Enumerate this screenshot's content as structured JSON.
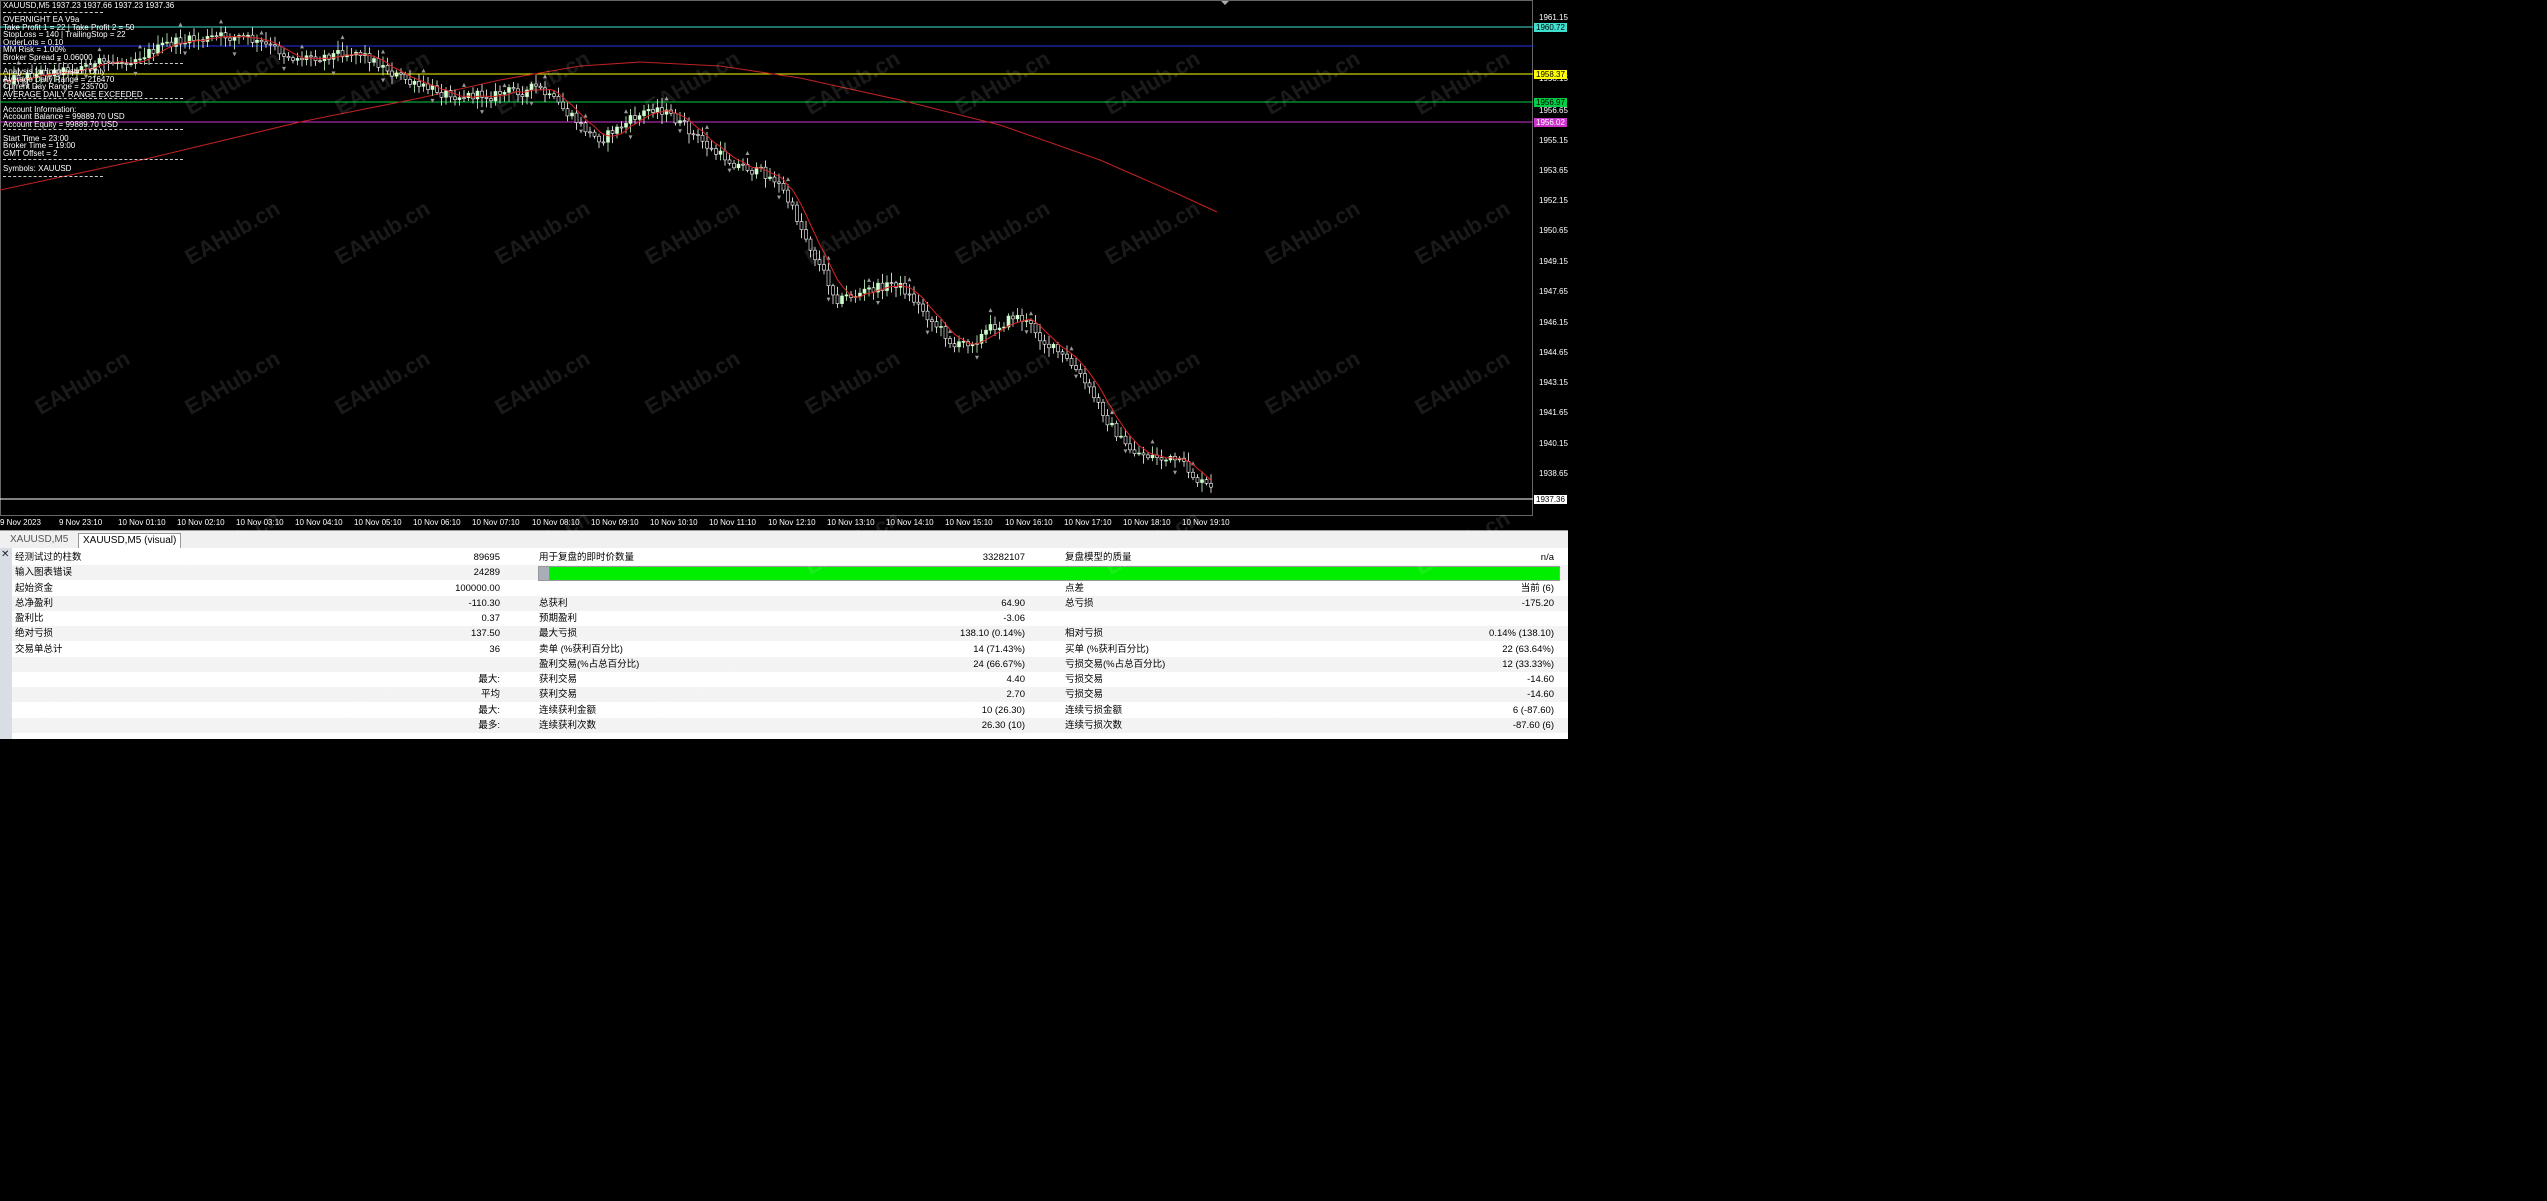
{
  "chart": {
    "header": "XAUUSD,M5  1937.23 1937.66 1937.23 1937.36",
    "info_lines": [
      "OVERNIGHT EA V9a",
      "Take Profit 1 = 22 | Take Profit 2 = 50",
      "StopLoss = 140 | TrailingStop = 22",
      "OrderLots = 0.10",
      "MM Risk = 1.00%",
      "Broker Spread = 0.06000",
      "Analysis for Information Only",
      "Average Daily Range = 216470",
      "Current Day Range = 235700",
      "AVERAGE DAILY RANGE EXCEEDED",
      "Account Information:",
      "Account Balance = 99889.70 USD",
      "Account Equity  = 99889.70 USD",
      "Start Time = 23:00",
      "Broker Time = 19:00",
      "GMT Offset = 2",
      "Symbols: XAUUSD"
    ],
    "price_ticks": [
      "1961.15",
      "1958.15",
      "1956.65",
      "1955.15",
      "1953.65",
      "1952.15",
      "1950.65",
      "1949.15",
      "1947.65",
      "1946.15",
      "1944.65",
      "1943.15",
      "1941.65",
      "1940.15",
      "1938.65"
    ],
    "price_tags": [
      {
        "text": "1960.72",
        "bg": "#40e0d0",
        "fg": "#000"
      },
      {
        "text": "1958.37",
        "bg": "#ffff00",
        "fg": "#000"
      },
      {
        "text": "1956.97",
        "bg": "#00cc44",
        "fg": "#000"
      },
      {
        "text": "1956.02",
        "bg": "#cc33cc",
        "fg": "#fff"
      },
      {
        "text": "1937.36",
        "bg": "#ffffff",
        "fg": "#000"
      }
    ],
    "time_ticks": [
      "9 Nov 2023",
      "9 Nov 23:10",
      "10 Nov 01:10",
      "10 Nov 02:10",
      "10 Nov 03:10",
      "10 Nov 04:10",
      "10 Nov 05:10",
      "10 Nov 06:10",
      "10 Nov 07:10",
      "10 Nov 08:10",
      "10 Nov 09:10",
      "10 Nov 10:10",
      "10 Nov 11:10",
      "10 Nov 12:10",
      "10 Nov 13:10",
      "10 Nov 14:10",
      "10 Nov 15:10",
      "10 Nov 16:10",
      "10 Nov 17:10",
      "10 Nov 18:10",
      "10 Nov 19:10"
    ],
    "watermark": "EAHub.cn",
    "colors": {
      "bull": "#ccffcc",
      "bear": "#ffffff",
      "ma_fast": "#dd2222",
      "ma_slow": "#bb2222"
    }
  },
  "tabs": [
    "XAUUSD,M5",
    "XAUUSD,M5 (visual)"
  ],
  "results": {
    "rows": [
      {
        "c1l": "经测试过的柱数",
        "c1v": "89695",
        "c2l": "用于复盘的即时价数量",
        "c2v": "33282107",
        "c3l": "复盘模型的质量",
        "c3v": "n/a"
      },
      {
        "c1l": "输入图表错误",
        "c1v": "24289",
        "c2l": "",
        "c2v": "",
        "c3l": "",
        "c3v": ""
      },
      {
        "c1l": "起始资金",
        "c1v": "100000.00",
        "c2l": "",
        "c2v": "",
        "c3l": "点差",
        "c3v": "当前 (6)"
      },
      {
        "c1l": "总净盈利",
        "c1v": "-110.30",
        "c2l": "总获利",
        "c2v": "64.90",
        "c3l": "总亏损",
        "c3v": "-175.20"
      },
      {
        "c1l": "盈利比",
        "c1v": "0.37",
        "c2l": "预期盈利",
        "c2v": "-3.06",
        "c3l": "",
        "c3v": ""
      },
      {
        "c1l": "绝对亏损",
        "c1v": "137.50",
        "c2l": "最大亏损",
        "c2v": "138.10 (0.14%)",
        "c3l": "相对亏损",
        "c3v": "0.14% (138.10)"
      },
      {
        "c1l": "交易单总计",
        "c1v": "36",
        "c2l": "卖单 (%获利百分比)",
        "c2v": "14 (71.43%)",
        "c3l": "买单 (%获利百分比)",
        "c3v": "22 (63.64%)"
      },
      {
        "c1l": "",
        "c1v": "",
        "c2l": "盈利交易(%占总百分比)",
        "c2v": "24 (66.67%)",
        "c3l": "亏损交易(%占总百分比)",
        "c3v": "12 (33.33%)"
      },
      {
        "c1l": "",
        "c1v": "最大:",
        "c2l": "获利交易",
        "c2v": "4.40",
        "c3l": "亏损交易",
        "c3v": "-14.60"
      },
      {
        "c1l": "",
        "c1v": "平均",
        "c2l": "获利交易",
        "c2v": "2.70",
        "c3l": "亏损交易",
        "c3v": "-14.60"
      },
      {
        "c1l": "",
        "c1v": "最大:",
        "c2l": "连续获利金额",
        "c2v": "10 (26.30)",
        "c3l": "连续亏损金额",
        "c3v": "6 (-87.60)"
      },
      {
        "c1l": "",
        "c1v": "最多:",
        "c2l": "连续获利次数",
        "c2v": "26.30 (10)",
        "c3l": "连续亏损次数",
        "c3v": "-87.60 (6)"
      }
    ]
  }
}
